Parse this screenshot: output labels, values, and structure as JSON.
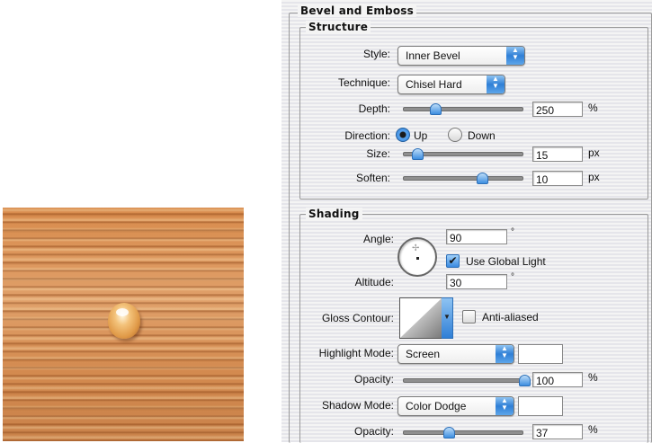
{
  "bevel_emboss": {
    "title": "Bevel and Emboss",
    "structure": {
      "title": "Structure",
      "style_label": "Style:",
      "style_value": "Inner Bevel",
      "technique_label": "Technique:",
      "technique_value": "Chisel Hard",
      "depth_label": "Depth:",
      "depth_value": "250",
      "depth_unit": "%",
      "depth_slider_fraction": 0.26,
      "direction_label": "Direction:",
      "direction_up": "Up",
      "direction_down": "Down",
      "direction_selected": "Up",
      "size_label": "Size:",
      "size_value": "15",
      "size_unit": "px",
      "size_slider_fraction": 0.11,
      "soften_label": "Soften:",
      "soften_value": "10",
      "soften_unit": "px",
      "soften_slider_fraction": 0.65
    },
    "shading": {
      "title": "Shading",
      "angle_label": "Angle:",
      "angle_value": "90",
      "angle_unit": "°",
      "use_global_light_label": "Use Global Light",
      "use_global_light_checked": true,
      "altitude_label": "Altitude:",
      "altitude_value": "30",
      "altitude_unit": "°",
      "gloss_contour_label": "Gloss Contour:",
      "anti_aliased_label": "Anti-aliased",
      "anti_aliased_checked": false,
      "highlight_mode_label": "Highlight Mode:",
      "highlight_mode_value": "Screen",
      "highlight_opacity_label": "Opacity:",
      "highlight_opacity_value": "100",
      "highlight_opacity_unit": "%",
      "highlight_opacity_fraction": 1.0,
      "shadow_mode_label": "Shadow Mode:",
      "shadow_mode_value": "Color Dodge",
      "shadow_opacity_label": "Opacity:",
      "shadow_opacity_value": "37",
      "shadow_opacity_unit": "%",
      "shadow_opacity_fraction": 0.37
    }
  },
  "icons": {
    "popup_arrows": "up-down-arrows-icon",
    "checkmark": "✔"
  },
  "colors": {
    "accent": "#2f7fd6",
    "wood": "#d88b4c"
  }
}
